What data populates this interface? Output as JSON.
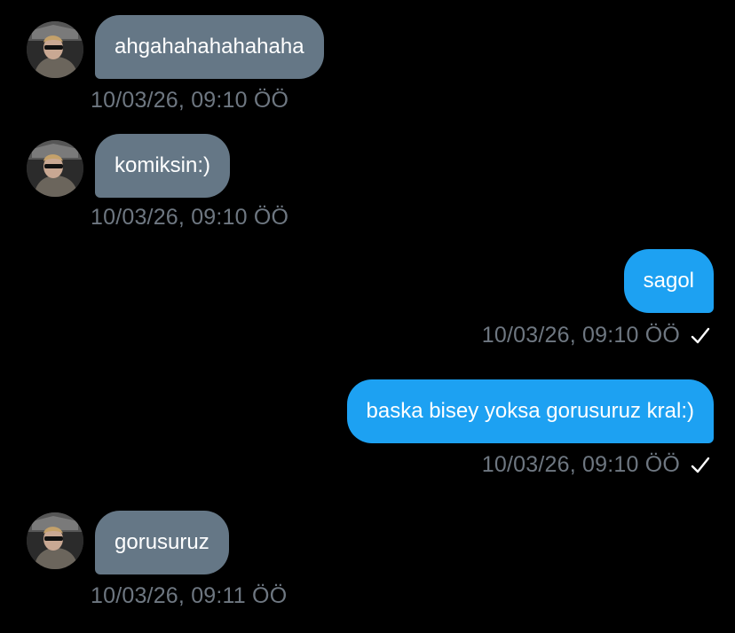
{
  "messages": [
    {
      "side": "in",
      "text": "ahgahahahahahaha",
      "time": "10/03/26, 09:10 ÖÖ"
    },
    {
      "side": "in",
      "text": "komiksin:)",
      "time": "10/03/26, 09:10 ÖÖ"
    },
    {
      "side": "out",
      "text": "sagol",
      "time": "10/03/26, 09:10 ÖÖ",
      "status_icon": "checkmark-icon"
    },
    {
      "side": "out",
      "text": "baska bisey yoksa gorusuruz kral:)",
      "time": "10/03/26, 09:10 ÖÖ",
      "status_icon": "checkmark-icon"
    },
    {
      "side": "in",
      "text": "gorusuruz",
      "time": "10/03/26, 09:11 ÖÖ"
    }
  ],
  "colors": {
    "background": "#000000",
    "incoming_bubble": "#657786",
    "outgoing_bubble": "#1da1f2",
    "timestamp": "#6e7781"
  }
}
